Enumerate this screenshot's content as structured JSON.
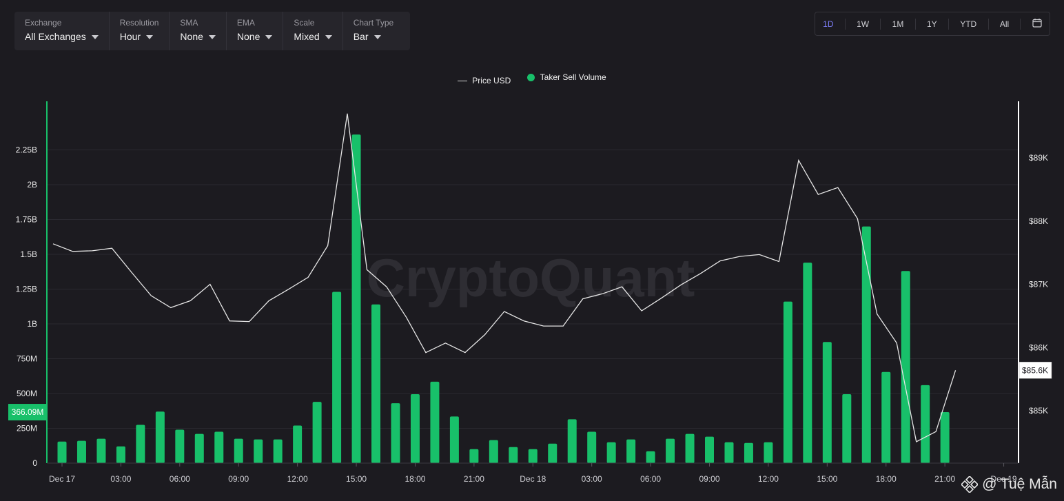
{
  "filters": [
    {
      "label": "Exchange",
      "value": "All Exchanges"
    },
    {
      "label": "Resolution",
      "value": "Hour"
    },
    {
      "label": "SMA",
      "value": "None"
    },
    {
      "label": "EMA",
      "value": "None"
    },
    {
      "label": "Scale",
      "value": "Mixed"
    },
    {
      "label": "Chart Type",
      "value": "Bar"
    }
  ],
  "ranges": [
    "1D",
    "1W",
    "1M",
    "1Y",
    "YTD",
    "All"
  ],
  "active_range": "1D",
  "colors": {
    "bar": "#18c06a",
    "price_line": "#e6e6e6",
    "background": "#1c1b20",
    "grid": "#2a2930"
  },
  "watermark": "CryptoQuant",
  "credit": "@ Tuệ Mẫn",
  "chart_data": {
    "type": "bar",
    "legend": [
      {
        "name": "Price USD",
        "type": "line"
      },
      {
        "name": "Taker Sell Volume",
        "type": "bar"
      }
    ],
    "x_ticks": [
      "Dec 17",
      "03:00",
      "06:00",
      "09:00",
      "12:00",
      "15:00",
      "18:00",
      "21:00",
      "Dec 18",
      "03:00",
      "06:00",
      "09:00",
      "12:00",
      "15:00",
      "18:00",
      "21:00",
      "Dec 19"
    ],
    "y_left_ticks": [
      "0",
      "250M",
      "500M",
      "750M",
      "1B",
      "1.25B",
      "1.5B",
      "1.75B",
      "2B",
      "2.25B"
    ],
    "y_left_range": [
      0,
      2500000000
    ],
    "y_right_ticks": [
      "$85K",
      "$86K",
      "$87K",
      "$88K",
      "$89K"
    ],
    "y_right_range": [
      84400,
      89800
    ],
    "current_volume_label": "366.09M",
    "current_volume": 366090000,
    "current_price_label": "$85.6K",
    "current_price": 85640,
    "series": [
      {
        "name": "Taker Sell Volume",
        "values": [
          155000000,
          160000000,
          175000000,
          120000000,
          275000000,
          370000000,
          240000000,
          210000000,
          225000000,
          175000000,
          170000000,
          170000000,
          270000000,
          440000000,
          1230000000,
          2360000000,
          1140000000,
          430000000,
          495000000,
          585000000,
          335000000,
          100000000,
          165000000,
          115000000,
          100000000,
          140000000,
          315000000,
          225000000,
          150000000,
          170000000,
          85000000,
          175000000,
          210000000,
          190000000,
          150000000,
          145000000,
          150000000,
          1160000000,
          1440000000,
          870000000,
          495000000,
          1700000000,
          655000000,
          1380000000,
          560000000,
          366090000
        ]
      },
      {
        "name": "Price USD",
        "values": [
          87640,
          87520,
          87530,
          87570,
          87190,
          86820,
          86630,
          86740,
          87000,
          86420,
          86410,
          86740,
          86920,
          87110,
          87610,
          89700,
          87230,
          86960,
          86480,
          85920,
          86070,
          85920,
          86200,
          86570,
          86420,
          86340,
          86340,
          86770,
          86850,
          86960,
          86580,
          86780,
          86990,
          87170,
          87370,
          87440,
          87470,
          87360,
          88960,
          88420,
          88530,
          88040,
          86530,
          86070,
          84510,
          84670,
          85640
        ]
      }
    ]
  }
}
